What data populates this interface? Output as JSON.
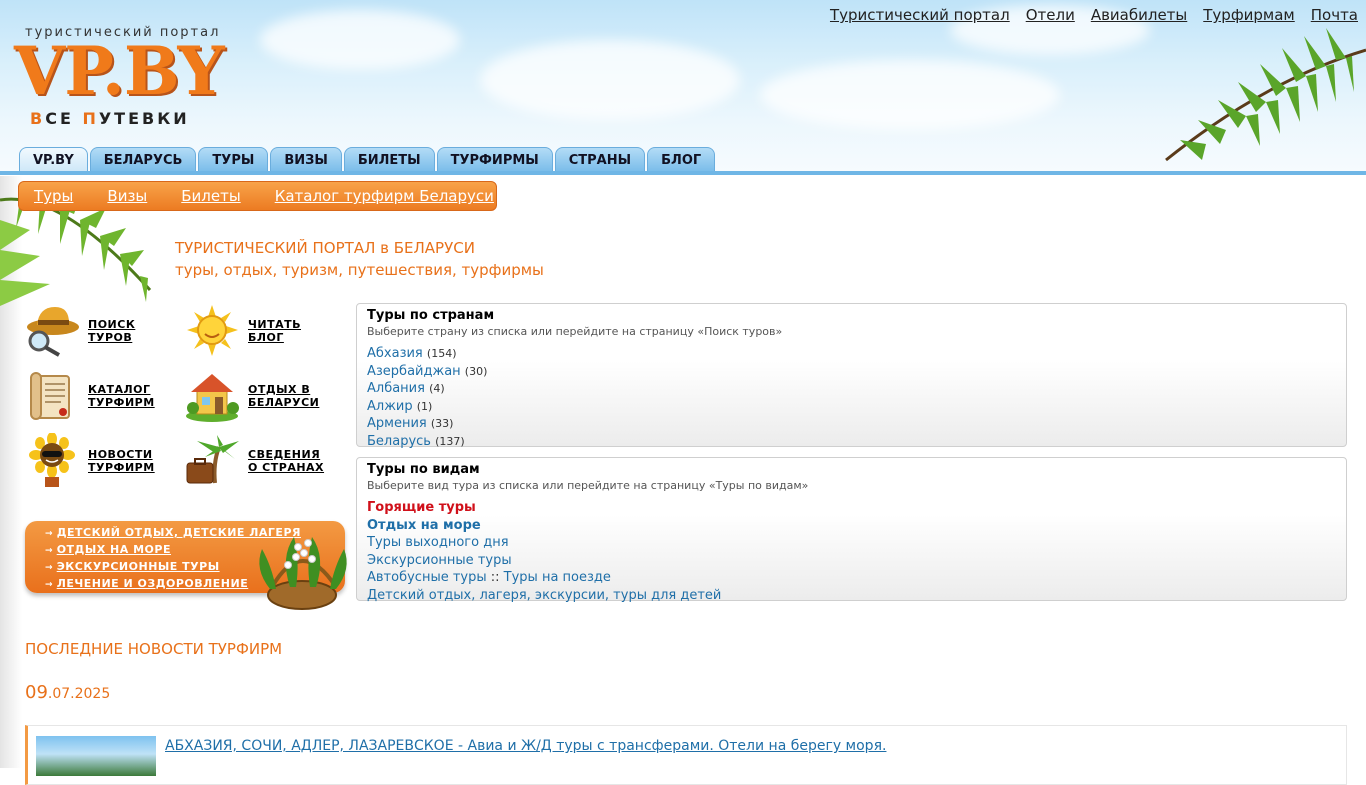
{
  "header": {
    "tagline": "туристический портал",
    "logo": "VP.BY",
    "slogan_first1": "В",
    "slogan_rest1": "СЕ ",
    "slogan_first2": "П",
    "slogan_rest2": "УТЕВКИ",
    "top_links": [
      "Туристический портал",
      "Отели",
      "Авиабилеты",
      "Турфирмам",
      "Почта"
    ],
    "tabs": [
      "VP.BY",
      "БЕЛАРУСЬ",
      "ТУРЫ",
      "ВИЗЫ",
      "БИЛЕТЫ",
      "ТУРФИРМЫ",
      "СТРАНЫ",
      "БЛОГ"
    ]
  },
  "subnav": [
    "Туры",
    "Визы",
    "Билеты",
    "Каталог турфирм Беларуси"
  ],
  "intro": {
    "title": "ТУРИСТИЧЕСКИЙ ПОРТАЛ в БЕЛАРУСИ",
    "subtitle": "туры, отдых, туризм, путешествия, турфирмы"
  },
  "icon_menu": [
    {
      "line1": "ПОИСК",
      "line2": "ТУРОВ",
      "icon": "hat-magnifier-icon"
    },
    {
      "line1": "ЧИТАТЬ",
      "line2": "БЛОГ",
      "icon": "sun-icon"
    },
    {
      "line1": "КАТАЛОГ",
      "line2": "ТУРФИРМ",
      "icon": "scroll-icon"
    },
    {
      "line1": "ОТДЫХ В",
      "line2": "БЕЛАРУСИ",
      "icon": "house-icon"
    },
    {
      "line1": "НОВОСТИ",
      "line2": "ТУРФИРМ",
      "icon": "sunflower-icon"
    },
    {
      "line1": "СВЕДЕНИЯ",
      "line2": "О СТРАНАХ",
      "icon": "palm-suitcase-icon"
    }
  ],
  "promo": [
    "ДЕТСКИЙ ОТДЫХ, ДЕТСКИЕ ЛАГЕРЯ",
    "ОТДЫХ НА МОРЕ",
    "ЭКСКУРСИОННЫЕ ТУРЫ",
    "ЛЕЧЕНИЕ И ОЗДОРОВЛЕНИЕ"
  ],
  "countries_box": {
    "title": "Туры по странам",
    "hint_prefix": "Выберите страну из списка или перейдите на страницу «",
    "hint_link": "Поиск туров",
    "hint_suffix": "»",
    "items": [
      {
        "name": "Абхазия",
        "count": "(154)"
      },
      {
        "name": "Азербайджан",
        "count": "(30)"
      },
      {
        "name": "Албания",
        "count": "(4)"
      },
      {
        "name": "Алжир",
        "count": "(1)"
      },
      {
        "name": "Армения",
        "count": "(33)"
      },
      {
        "name": "Беларусь",
        "count": "(137)"
      }
    ]
  },
  "types_box": {
    "title": "Туры по видам",
    "hint_prefix": "Выберите вид тура из списка или перейдите на страницу «",
    "hint_link": "Туры по видам",
    "hint_suffix": "»",
    "hot": "Горящие туры",
    "sea": "Отдых на море",
    "weekend": "Туры выходного дня",
    "excursion": "Экскурсионные туры",
    "bus": "Автобусные туры",
    "separator": "::",
    "train": "Туры на поезде",
    "kids": "Детский отдых, лагеря, экскурсии, туры для детей"
  },
  "news": {
    "section_title": "ПОСЛЕДНИЕ НОВОСТИ ТУРФИРМ",
    "date_day": "09",
    "date_rest": ".07.2025",
    "item_title": "АБХАЗИЯ, СОЧИ, АДЛЕР, ЛАЗАРЕВСКОЕ - Авиа и Ж/Д туры с трансферами. Отели на берегу моря."
  }
}
